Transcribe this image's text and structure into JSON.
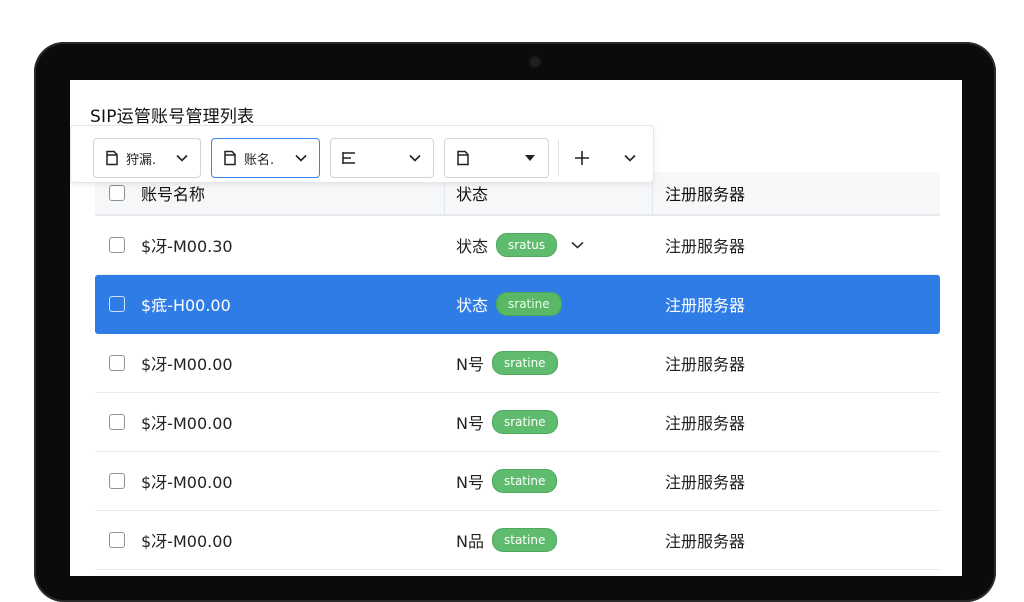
{
  "page": {
    "title": "SIP运管账号管理列表"
  },
  "toolbar": {
    "buttons": [
      {
        "label": "狩漏.",
        "icon": "document-icon"
      },
      {
        "label": "账名.",
        "icon": "document-icon"
      },
      {
        "label": "",
        "icon": "align-left-icon"
      },
      {
        "label": "",
        "icon": "document-icon"
      },
      {
        "label": "",
        "icon": "plus-icon"
      }
    ]
  },
  "table": {
    "headers": {
      "name": "账号名称",
      "status": "状态",
      "server": "注册服务器"
    },
    "rows": [
      {
        "name": "$冴-M00.30",
        "status_text": "状态",
        "badge": "sratus",
        "server": "注册服务器",
        "selected": false,
        "has_dropdown": true
      },
      {
        "name": "$疷-H00.00",
        "status_text": "状态",
        "badge": "sratine",
        "server": "注册服务器",
        "selected": true,
        "has_dropdown": false
      },
      {
        "name": "$冴-M00.00",
        "status_text": "N号",
        "badge": "sratine",
        "server": "注册服务器",
        "selected": false,
        "has_dropdown": false
      },
      {
        "name": "$冴-M00.00",
        "status_text": "N号",
        "badge": "sratine",
        "server": "注册服务器",
        "selected": false,
        "has_dropdown": false
      },
      {
        "name": "$冴-M00.00",
        "status_text": "N号",
        "badge": "statine",
        "server": "注册服务器",
        "selected": false,
        "has_dropdown": false
      },
      {
        "name": "$冴-M00.00",
        "status_text": "N品",
        "badge": "statine",
        "server": "注册服务器",
        "selected": false,
        "has_dropdown": false
      }
    ]
  },
  "colors": {
    "selected_row": "#2f7ce6",
    "badge_green": "#5fbb6e",
    "bezel": "#0b0b0b"
  }
}
